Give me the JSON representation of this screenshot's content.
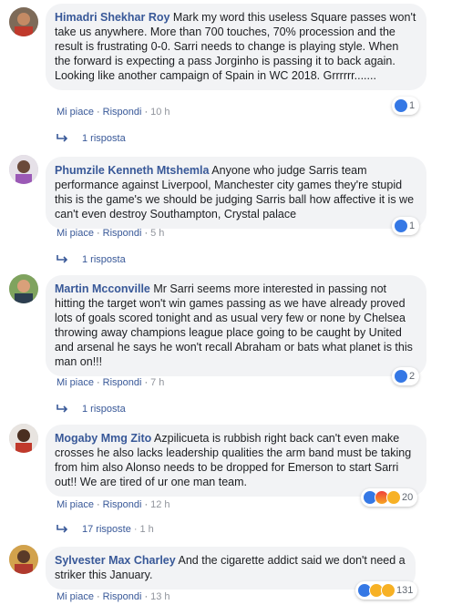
{
  "ui": {
    "like": "Mi piace",
    "reply": "Rispondi",
    "sep": "·"
  },
  "colors": {
    "link": "#385898",
    "bubble": "#f2f3f5",
    "like_blue": "#3578e5"
  },
  "comments": [
    {
      "author": "Himadri Shekhar Roy",
      "text": "Mark my word this useless Square passes won't take us anywhere. More than 700 touches, 70% procession and the result is frustrating 0-0. Sarri needs to change is playing style. When the forward is expecting a pass Jorginho is passing it to back again. Looking like another campaign of Spain in WC 2018. Grrrrrr.......",
      "time": "10 h",
      "reaction_count": "1",
      "reaction_icons": [
        "like-icon"
      ],
      "replies": "1 risposta",
      "replies_time": ""
    },
    {
      "author": "Phumzile Kenneth Mtshemla",
      "text": "Anyone who judge Sarris team performance against Liverpool, Manchester city games they're stupid this is the game's we should be judging Sarris ball how affective it is we can't even destroy Southampton, Crystal palace",
      "time": "5 h",
      "reaction_count": "1",
      "reaction_icons": [
        "like-icon"
      ],
      "replies": "1 risposta",
      "replies_time": ""
    },
    {
      "author": "Martin Mcconville",
      "text": "Mr Sarri seems more interested in passing not hitting the target won't win games passing as we have already proved lots of goals scored tonight and as usual very few or none by Chelsea throwing away champions league place going to be caught by United and arsenal he says he won't recall Abraham or bats what planet is this man on!!!",
      "time": "7 h",
      "reaction_count": "2",
      "reaction_icons": [
        "like-icon"
      ],
      "replies": "1 risposta",
      "replies_time": ""
    },
    {
      "author": "Mogaby Mmg Zito",
      "text": "Azpilicueta is rubbish right back can't even make crosses he also lacks leadership qualities the arm band must be taking from him also Alonso needs to be dropped for Emerson to start Sarri out!! We are tired of ur one man team.",
      "time": "12 h",
      "reaction_count": "20",
      "reaction_icons": [
        "like-icon",
        "angry-icon",
        "wow-icon"
      ],
      "replies": "17 risposte",
      "replies_time": "1 h"
    },
    {
      "author": "Sylvester Max Charley",
      "text": "And the cigarette addict said we don't need a striker this January.",
      "time": "13 h",
      "reaction_count": "131",
      "reaction_icons": [
        "like-icon",
        "wow-icon",
        "wow-icon"
      ],
      "replies": "",
      "replies_time": ""
    }
  ]
}
